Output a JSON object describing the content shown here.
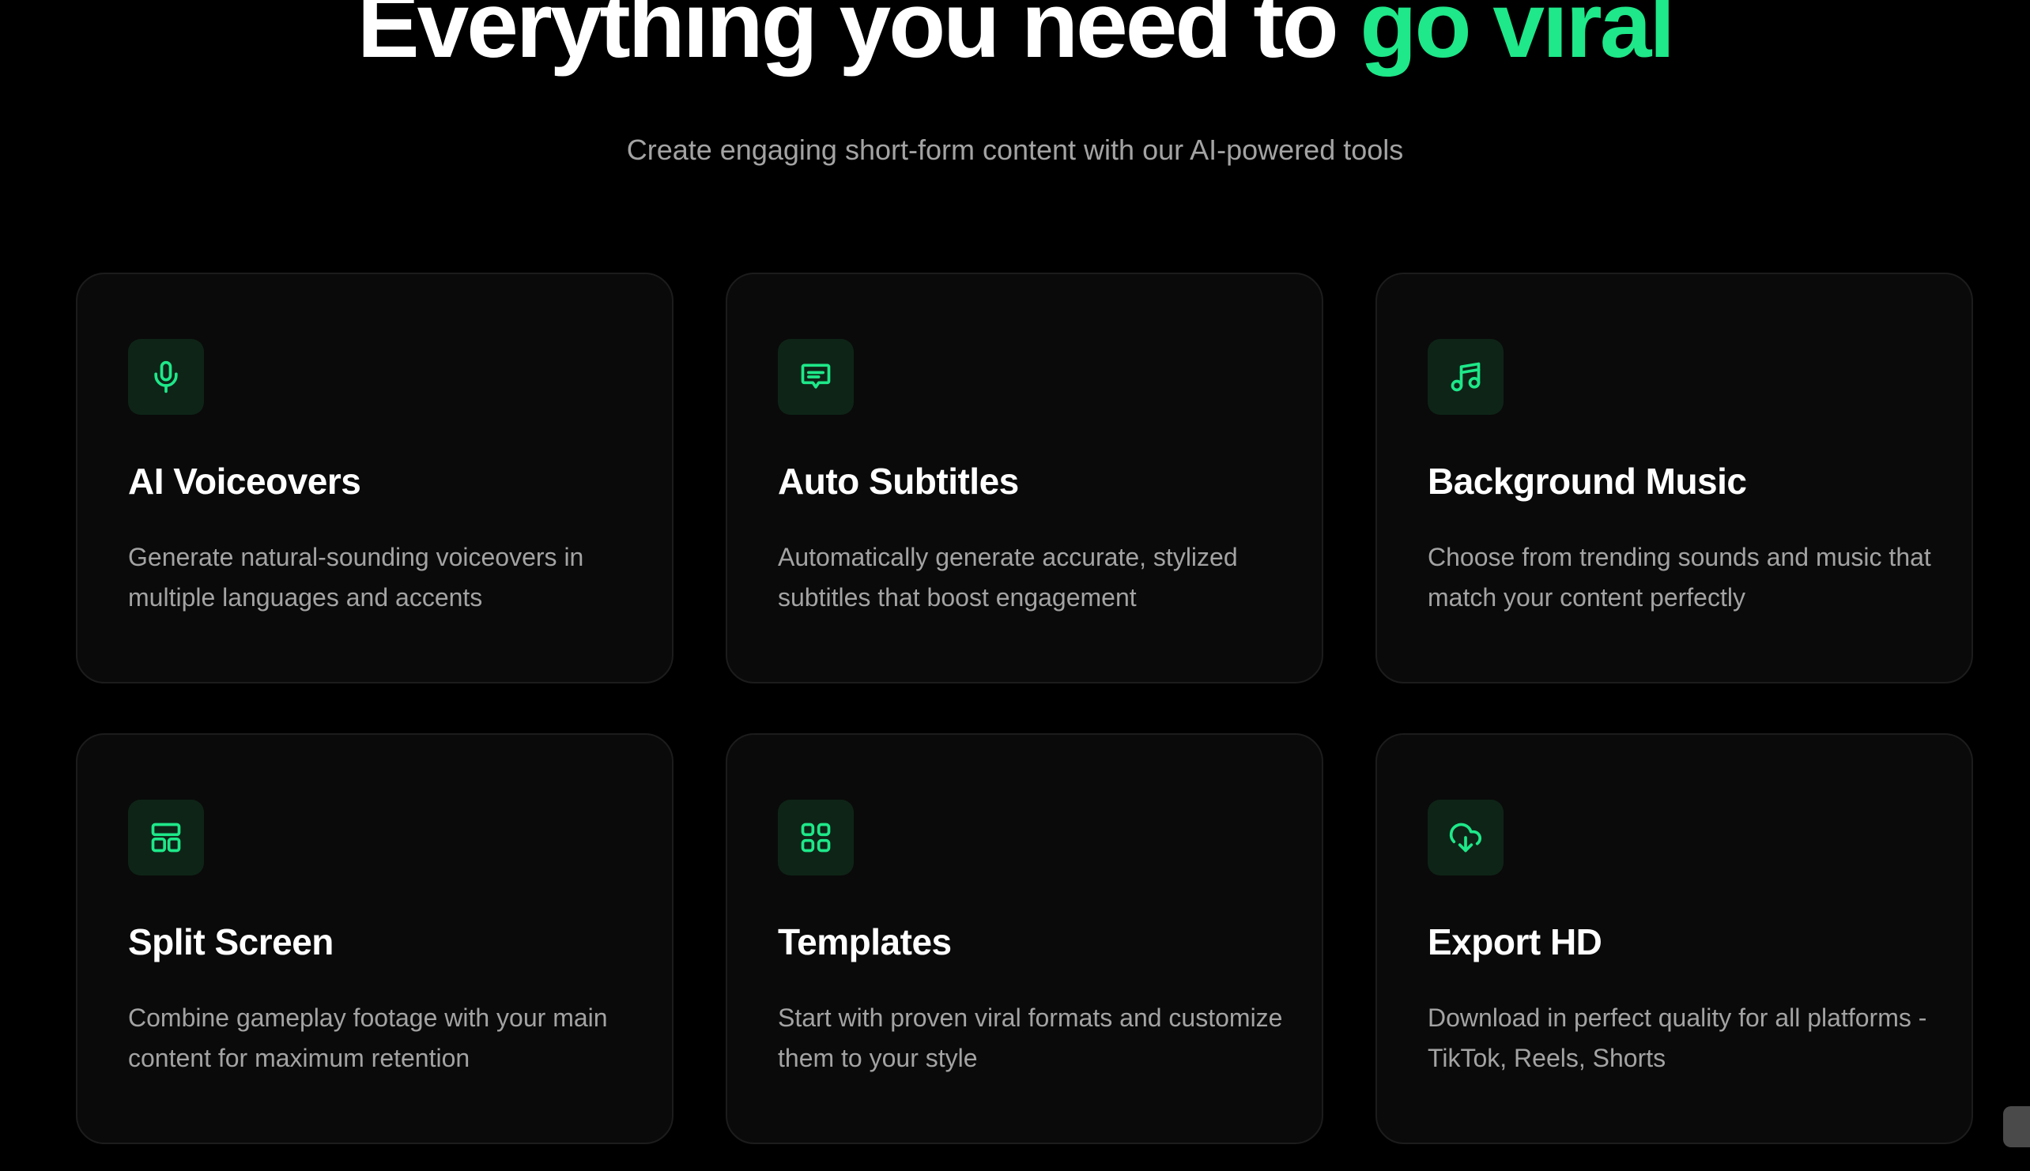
{
  "hero": {
    "title_main": "Everything you need to",
    "title_accent": "go viral",
    "subtitle": "Create engaging short-form content with our AI-powered tools"
  },
  "colors": {
    "background": "#000000",
    "accent": "#1ee889",
    "card_background": "#0a0a0a",
    "icon_background": "#0e2417",
    "muted_text": "#a3a3a3"
  },
  "features": [
    {
      "icon": "microphone-icon",
      "title": "AI Voiceovers",
      "description": "Generate natural-sounding voiceovers in multiple languages and accents"
    },
    {
      "icon": "message-square-text-icon",
      "title": "Auto Subtitles",
      "description": "Automatically generate accurate, stylized subtitles that boost engagement"
    },
    {
      "icon": "music-icon",
      "title": "Background Music",
      "description": "Choose from trending sounds and music that match your content perfectly"
    },
    {
      "icon": "layout-panels-icon",
      "title": "Split Screen",
      "description": "Combine gameplay footage with your main content for maximum retention"
    },
    {
      "icon": "grid-icon",
      "title": "Templates",
      "description": "Start with proven viral formats and customize them to your style"
    },
    {
      "icon": "cloud-download-icon",
      "title": "Export HD",
      "description": "Download in perfect quality for all platforms - TikTok, Reels, Shorts"
    }
  ]
}
